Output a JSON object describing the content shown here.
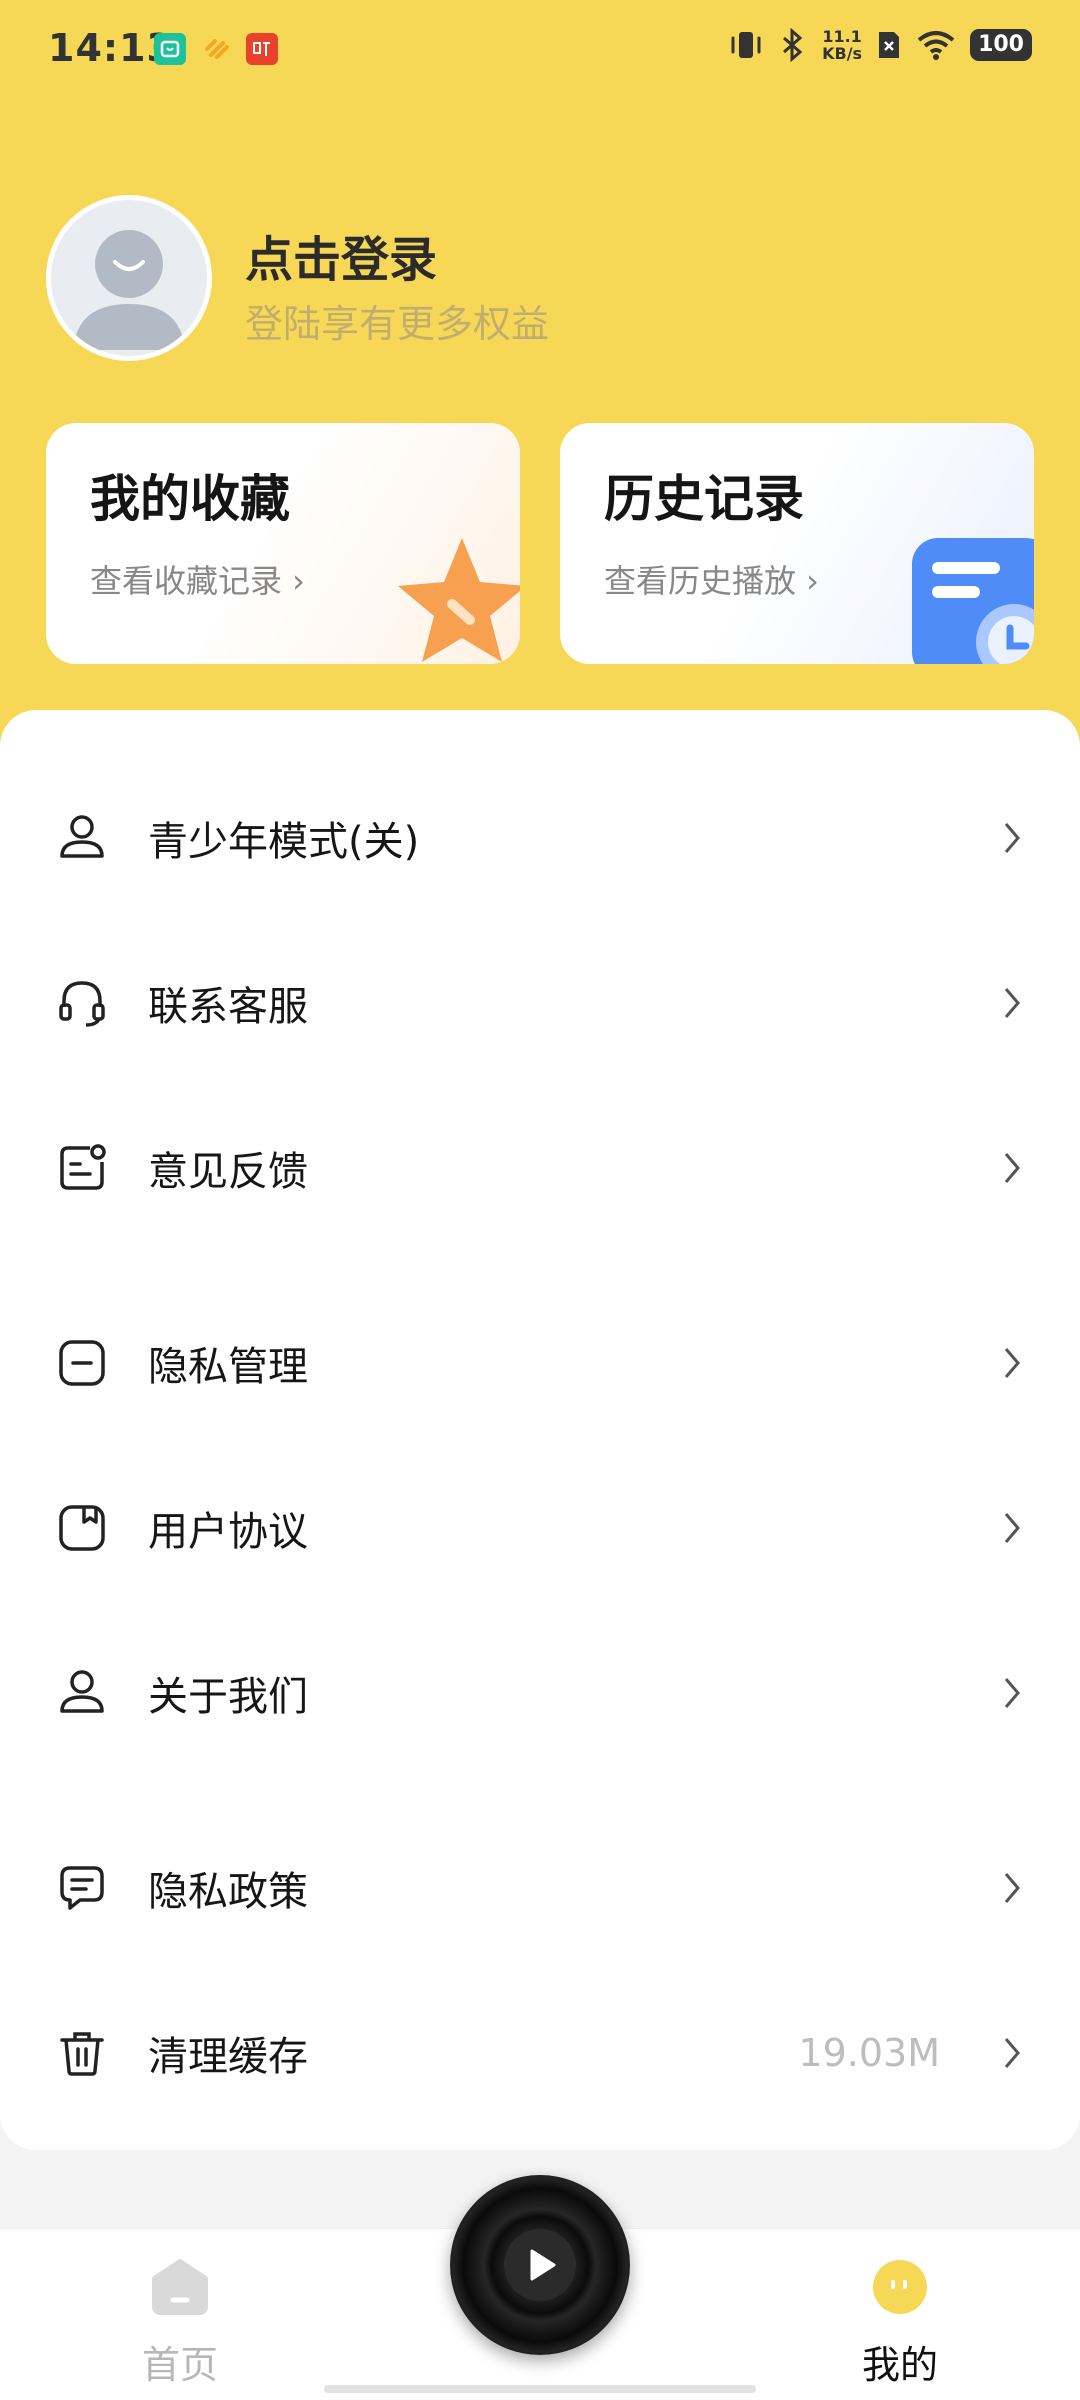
{
  "status_bar": {
    "time": "14:13",
    "speed_value": "11.1",
    "speed_unit": "KB/s",
    "battery": "100"
  },
  "profile": {
    "login_title": "点击登录",
    "login_subtitle": "登陆享有更多权益"
  },
  "cards": {
    "favorites": {
      "title": "我的收藏",
      "subtitle": "查看收藏记录 ›"
    },
    "history": {
      "title": "历史记录",
      "subtitle": "查看历史播放 ›"
    }
  },
  "menu": {
    "items": [
      {
        "label": "青少年模式(关)",
        "icon": "user-icon"
      },
      {
        "label": "联系客服",
        "icon": "headset-icon"
      },
      {
        "label": "意见反馈",
        "icon": "feedback-icon"
      },
      {
        "label": "隐私管理",
        "icon": "privacy-minus-icon"
      },
      {
        "label": "用户协议",
        "icon": "agreement-icon"
      },
      {
        "label": "关于我们",
        "icon": "user-icon"
      },
      {
        "label": "隐私政策",
        "icon": "chat-icon"
      },
      {
        "label": "清理缓存",
        "icon": "trash-icon",
        "value": "19.03M"
      }
    ]
  },
  "bottom_nav": {
    "home_label": "首页",
    "mine_label": "我的"
  },
  "colors": {
    "header_bg": "#f7d856",
    "accent_orange": "#f7a04f",
    "accent_blue": "#4f8cf7"
  }
}
